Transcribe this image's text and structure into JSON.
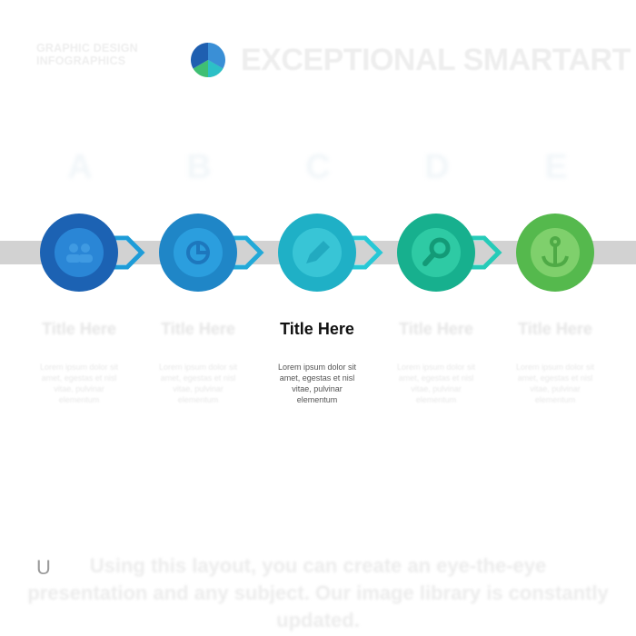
{
  "header": {
    "brand_line1": "GRAPHIC DESIGN",
    "brand_line2": "INFOGRAPHICS",
    "title": "EXCEPTIONAL SMARTART"
  },
  "colors": {
    "track": "#d2d2d2",
    "step_a": "#1f6fc4",
    "step_b": "#1f8fce",
    "step_c": "#21b5c8",
    "step_d": "#19b58a",
    "step_e": "#5cbd53",
    "arrow": "#27c3d8"
  },
  "steps": [
    {
      "letter": "A",
      "title": "Title Here",
      "body": "Lorem ipsum dolor sit amet, egestas et nisl vitae, pulvinar elementum",
      "icon": "users-icon",
      "color": "#1f6fc4"
    },
    {
      "letter": "B",
      "title": "Title Here",
      "body": "Lorem ipsum dolor sit amet, egestas et nisl vitae, pulvinar elementum",
      "icon": "chart-icon",
      "color": "#1f8fce"
    },
    {
      "letter": "C",
      "title": "Title Here",
      "body": "Lorem ipsum dolor sit amet, egestas et nisl vitae, pulvinar elementum",
      "icon": "pencil-icon",
      "color": "#21b5c8"
    },
    {
      "letter": "D",
      "title": "Title Here",
      "body": "Lorem ipsum dolor sit amet, egestas et nisl vitae, pulvinar elementum",
      "icon": "search-icon",
      "color": "#19b58a"
    },
    {
      "letter": "E",
      "title": "Title Here",
      "body": "Lorem ipsum dolor sit amet, egestas et nisl vitae, pulvinar elementum",
      "icon": "anchor-icon",
      "color": "#5cbd53"
    }
  ],
  "footer": {
    "text": "Using this layout, you can create an eye-the-eye presentation and any subject. Our image library is constantly updated.",
    "lead": "U"
  }
}
